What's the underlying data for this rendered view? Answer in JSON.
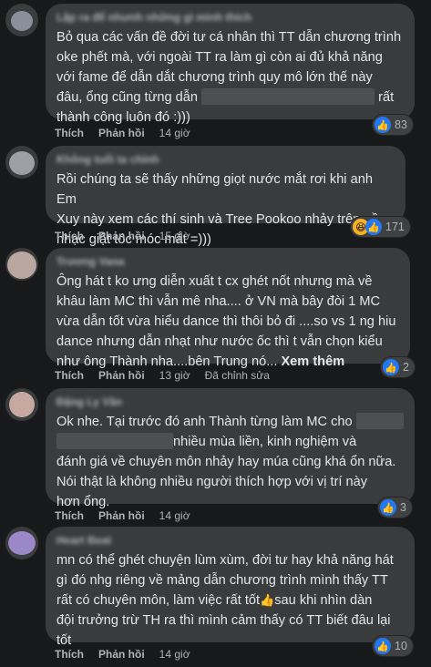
{
  "comments": [
    {
      "author": "Lập ra để nhưnh những gì mình thích",
      "text_a": "Bỏ qua các vấn đề đời tư cá nhân thì TT dẫn chương trình\noke phết mà, với ngoài TT ra làm gì còn ai đủ khả năng\nvới fame để dẫn dắt chương trình quy mô lớn thế này\nđâu, ổng cũng từng dẫn",
      "text_b": "rất\nthành công luôn đó :)))",
      "like": "Thích",
      "reply": "Phản hồi",
      "time": "14 giờ",
      "react_count": "83"
    },
    {
      "author": "Không tuổi ta chính",
      "text": "Rồi chúng ta sẽ thấy những giọt nước mắt rơi khi anh Em\nXuy này xem các thí sinh và Tree Pookoo nhảy trên nền\nnhạc giật tóc móc mắt =)))",
      "like": "Thích",
      "reply": "Phản hồi",
      "time": "15 giờ",
      "react_count": "171"
    },
    {
      "author": "Trương Vana",
      "text": "Ông hát t ko ưng diễn xuất t cx ghét nốt nhưng mà về\nkhâu làm MC thì vẫn mê nha.... ở VN mà bây đòi 1 MC\nvừa dẫn tốt vừa hiểu dance thì thôi bỏ đi ....so vs 1 ng hiu\ndance nhưng dẫn nhạt như nước ốc thì t vẫn chọn kiểu\nnhư ông Thành nha....bên Trung nó...",
      "see_more": "Xem thêm",
      "like": "Thích",
      "reply": "Phản hồi",
      "time": "13 giờ",
      "edited": "Đã chỉnh sửa",
      "react_count": "2"
    },
    {
      "author": "Đặng Ly Vân",
      "text_a": "Ok nhe. Tại trước đó anh Thành từng làm MC cho",
      "text_b": "nhiều mùa liền, kinh nghiệm và\nđánh giá về chuyên môn nhảy hay múa cũng khá ổn nữa.\nNói thật là không nhiều người thích hợp với vị trí này\nhơn ổng.",
      "like": "Thích",
      "reply": "Phản hồi",
      "time": "14 giờ",
      "react_count": "3"
    },
    {
      "author": "Heart Beat",
      "text_a": "mn có thể ghét chuyện lùm xùm, đời tư hay khả năng hát\ngì đó nhg riêng về mảng dẫn chương trình mình thấy TT\nrất có chuyên môn, làm việc rất tốt",
      "emoji": "👍",
      "text_b": "sau khi nhìn dàn\nđội trưởng trừ TH ra thì mình cảm thấy có TT biết đâu lại\ntốt",
      "like": "Thích",
      "reply": "Phản hồi",
      "time": "14 giờ",
      "react_count": "10"
    }
  ],
  "icons": {
    "like": "thumbs-up-icon",
    "haha": "haha-face-icon"
  },
  "colors": {
    "background": "#18191a",
    "bubble": "#3a3b3c",
    "like_blue": "#2078f4"
  }
}
